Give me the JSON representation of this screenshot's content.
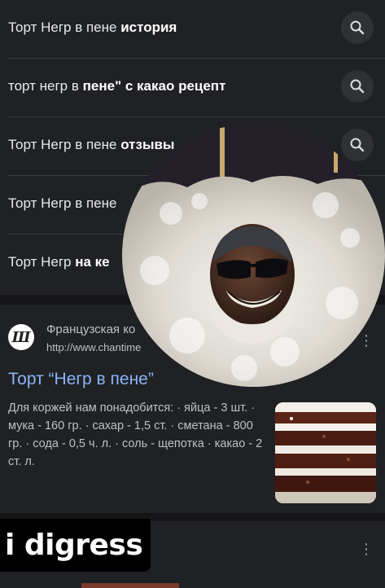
{
  "suggestions": [
    {
      "normal": "Торт Негр в пене ",
      "bold": "история",
      "tail": ""
    },
    {
      "normal": "торт негр в ",
      "bold": "пене\" с какао рецепт",
      "tail": ""
    },
    {
      "normal": "Торт Негр в пене ",
      "bold": "отзывы",
      "tail": ""
    },
    {
      "normal": "Торт Негр в пене",
      "bold": "",
      "tail": ""
    },
    {
      "normal": "Торт Негр ",
      "bold": "на ке",
      "tail": ""
    }
  ],
  "result": {
    "site_name": "Французская ко",
    "site_url": "http://www.chantime",
    "favicon_letter": "Ш",
    "title": "Торт “Негр в пене”",
    "snippet": "Для коржей нам понадобится: · яйца - 3 шт. · мука - 160 гр. · сахар - 1,5 ст. · сметана - 800 гр. · сода - 0,5 ч. л. · соль - щепотка · какао - 2 ст. л.",
    "more_icon": "kebab-icon"
  },
  "caption": "i digress",
  "icons": {
    "search": "search-icon",
    "more": "kebab-icon"
  },
  "colors": {
    "background": "#202124",
    "link": "#8ab4f8",
    "text": "#e8eaed",
    "muted": "#bdc1c6"
  }
}
